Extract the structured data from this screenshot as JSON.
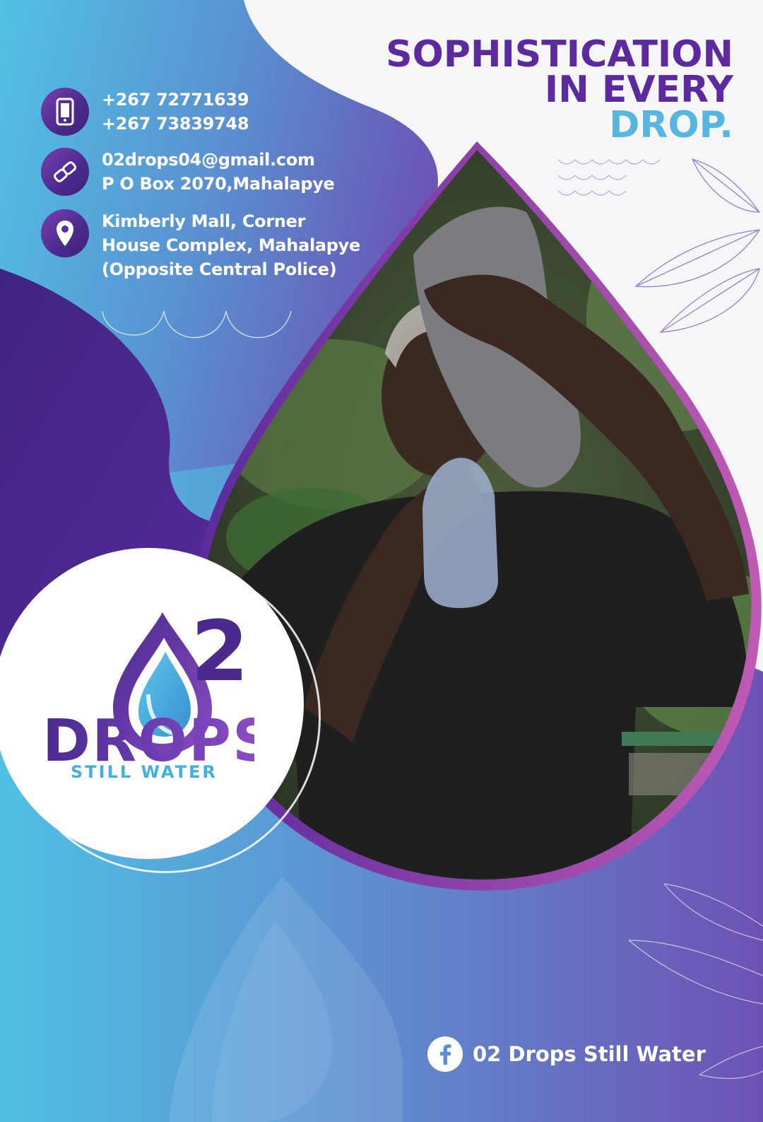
{
  "headline": {
    "line1": "SOPHISTICATION",
    "line2": "IN EVERY",
    "line3": "DROP."
  },
  "contacts": {
    "phone": {
      "icon": "phone-icon",
      "line1": "+267 72771639",
      "line2": "+267 73839748"
    },
    "email": {
      "icon": "link-icon",
      "line1": "02drops04@gmail.com",
      "line2": "P O Box 2070,Mahalapye"
    },
    "address": {
      "icon": "location-pin-icon",
      "line1": "Kimberly Mall, Corner",
      "line2": "House Complex, Mahalapye",
      "line3": "(Opposite Central Police)"
    }
  },
  "photo": {
    "description_icon": "photo-man-drinking-water"
  },
  "logo": {
    "word": "DROPS",
    "superscript": "2",
    "tagline": "STILL WATER"
  },
  "social": {
    "icon": "facebook-icon",
    "label": "02 Drops Still Water"
  },
  "colors": {
    "purple": "#5a2a9e",
    "light_blue": "#55b7df",
    "deep_purple": "#3b2275",
    "magenta_edge": "#b04fb0"
  }
}
